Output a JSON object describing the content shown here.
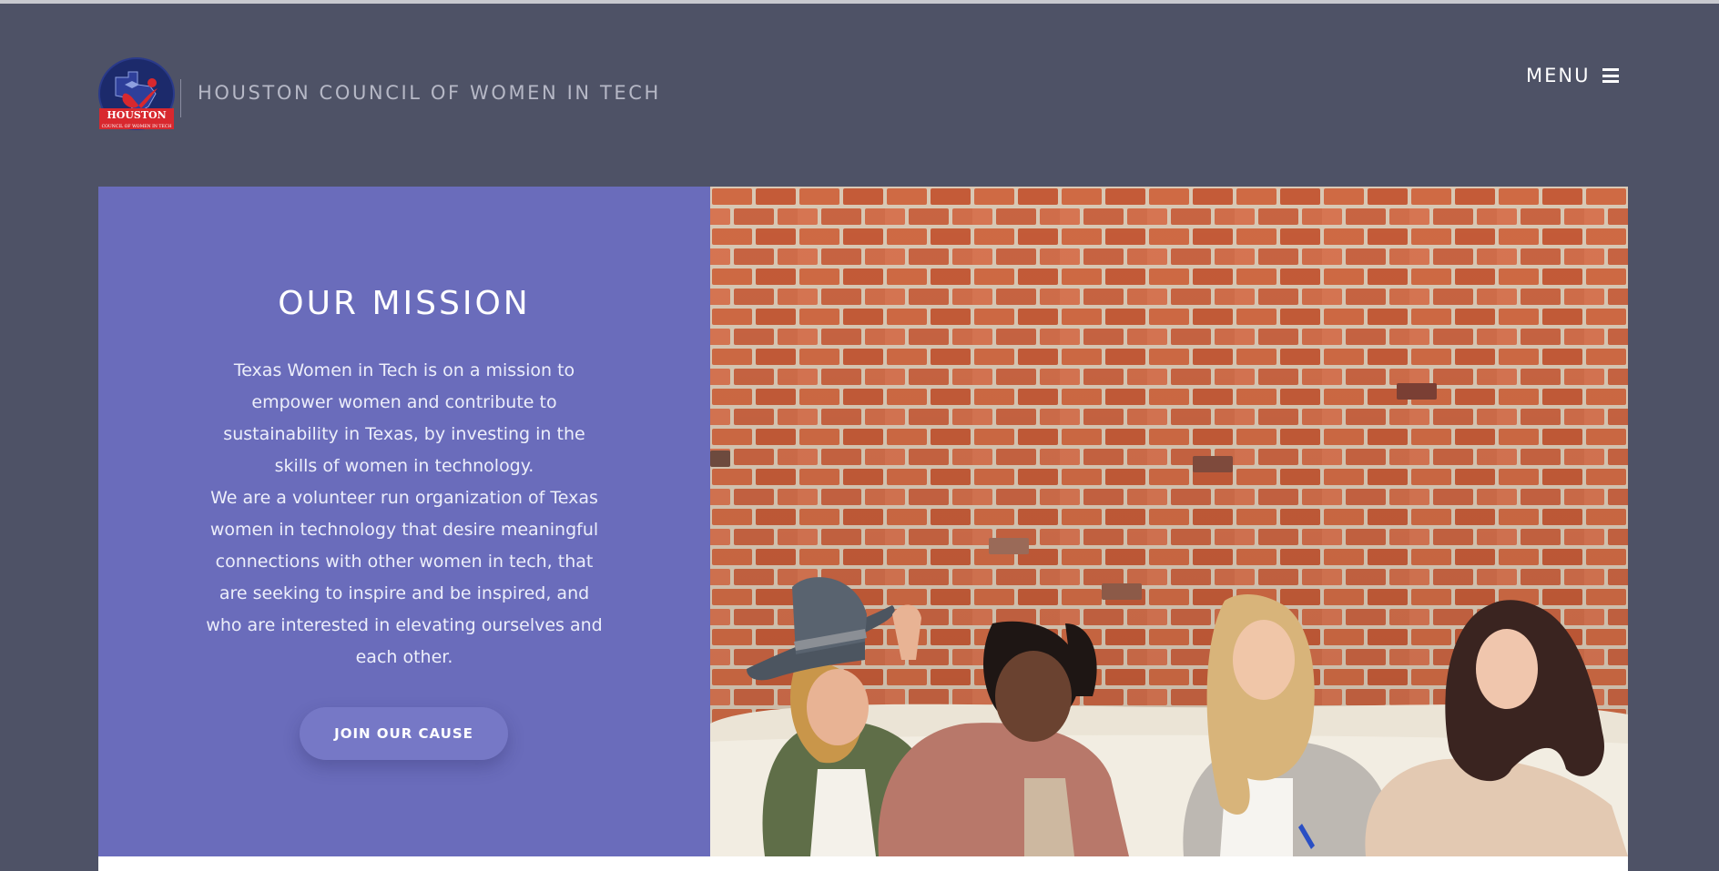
{
  "header": {
    "site_title": "HOUSTON COUNCIL OF WOMEN IN TECH",
    "logo": {
      "icon": "houston-council-logo",
      "text": "HOUSTON",
      "subtext": "COUNCIL OF WOMEN IN TECH"
    },
    "menu_label": "MENU",
    "menu_icon": "hamburger-icon"
  },
  "mission": {
    "heading": "OUR MISSION",
    "paragraph_1": "Texas Women in Tech is on a mission to empower women and contribute to sustainability in Texas, by investing in the skills of women in technology.",
    "paragraph_2": "We are a volunteer run organization of Texas women in technology that desire meaningful connections with other women in tech, that are seeking to inspire and be inspired, and who are interested in elevating ourselves and each other.",
    "cta_label": "JOIN OUR CAUSE"
  },
  "photo": {
    "alt": "Four women laughing together on a couch in front of a red brick wall"
  },
  "colors": {
    "background": "#4e5266",
    "mission_panel": "#6a6cbb",
    "button": "#7678c6",
    "brick": "#c7623f"
  }
}
